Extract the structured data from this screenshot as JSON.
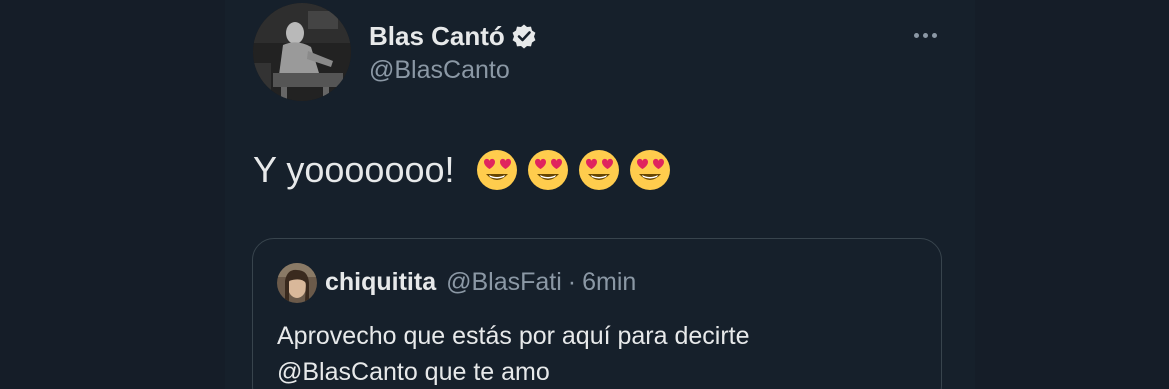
{
  "tweet": {
    "author_name": "Blas Cantó",
    "author_handle": "@BlasCanto",
    "verified": true,
    "text": "Y yooooooo!",
    "emojis": [
      "heart-eyes-emoji",
      "heart-eyes-emoji",
      "heart-eyes-emoji",
      "heart-eyes-emoji"
    ],
    "more_icon": "more-horizontal-icon"
  },
  "quote": {
    "author_name": "chiquitita",
    "author_handle": "@BlasFati",
    "separator": "·",
    "time": "6min",
    "text_line1": "Aprovecho que estás por aquí para decirte",
    "text_line2_mention": "@BlasCanto",
    "text_line2_rest": " que te amo"
  },
  "colors": {
    "background": "#151d28",
    "text_primary": "#e7e9ea",
    "text_secondary": "#8b98a5",
    "border": "#38444d"
  }
}
